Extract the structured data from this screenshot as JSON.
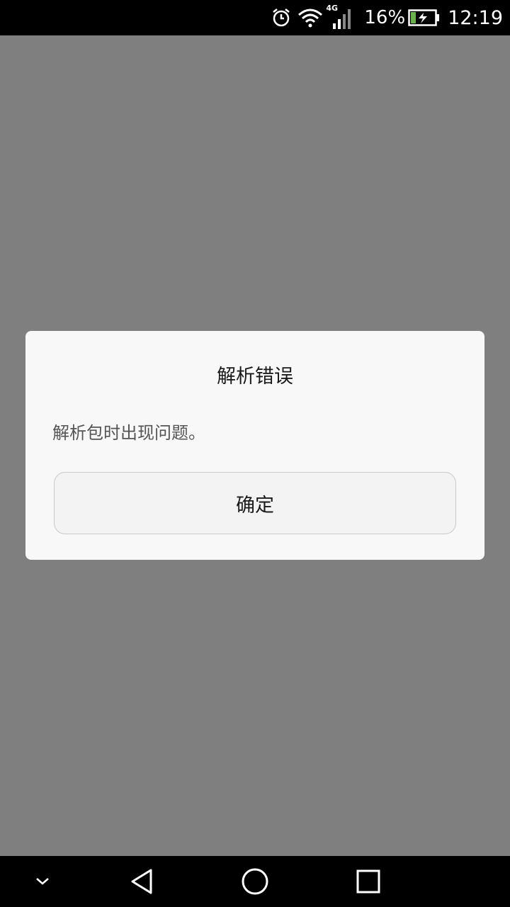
{
  "status_bar": {
    "network_type": "4G",
    "battery_percent": "16%",
    "time": "12:19",
    "icons": [
      "alarm-icon",
      "wifi-icon",
      "signal-icon",
      "battery-charging-icon"
    ]
  },
  "dialog": {
    "title": "解析错误",
    "message": "解析包时出现问题。",
    "ok_label": "确定"
  },
  "nav_bar": {
    "icons": [
      "chevron-down-icon",
      "back-icon",
      "home-icon",
      "recents-icon"
    ]
  },
  "colors": {
    "scrim": "#7f7f7f",
    "dialog_bg": "#f8f8f8",
    "bars": "#000000",
    "battery_fill": "#6ab04c"
  }
}
